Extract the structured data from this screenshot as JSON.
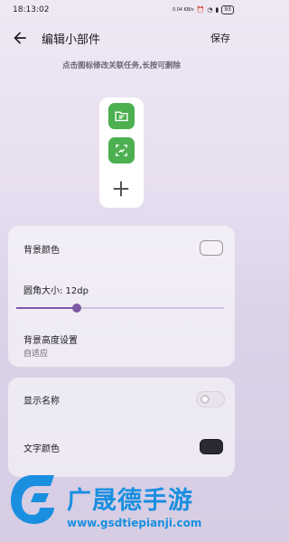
{
  "status": {
    "time": "18:13:02",
    "net_speed": "0.04 KB/s",
    "battery": "93"
  },
  "appbar": {
    "title": "编辑小部件",
    "save_label": "保存"
  },
  "hint": "点击图标修改关联任务,长按可删除",
  "settings": {
    "bg_color_label": "背景颜色",
    "radius_label": "圆角大小: 12dp",
    "radius_fraction": 0.29,
    "bg_height_label": "背景高度设置",
    "bg_height_value": "自适应",
    "show_name_label": "显示名称",
    "text_color_label": "文字颜色"
  },
  "colors": {
    "accent": "#7e5aa5",
    "task_green": "#4caf50",
    "text_color": "#2a2a32"
  },
  "watermark": {
    "brand": "广晟德手游",
    "url": "www.gsdtiepianji.com"
  }
}
